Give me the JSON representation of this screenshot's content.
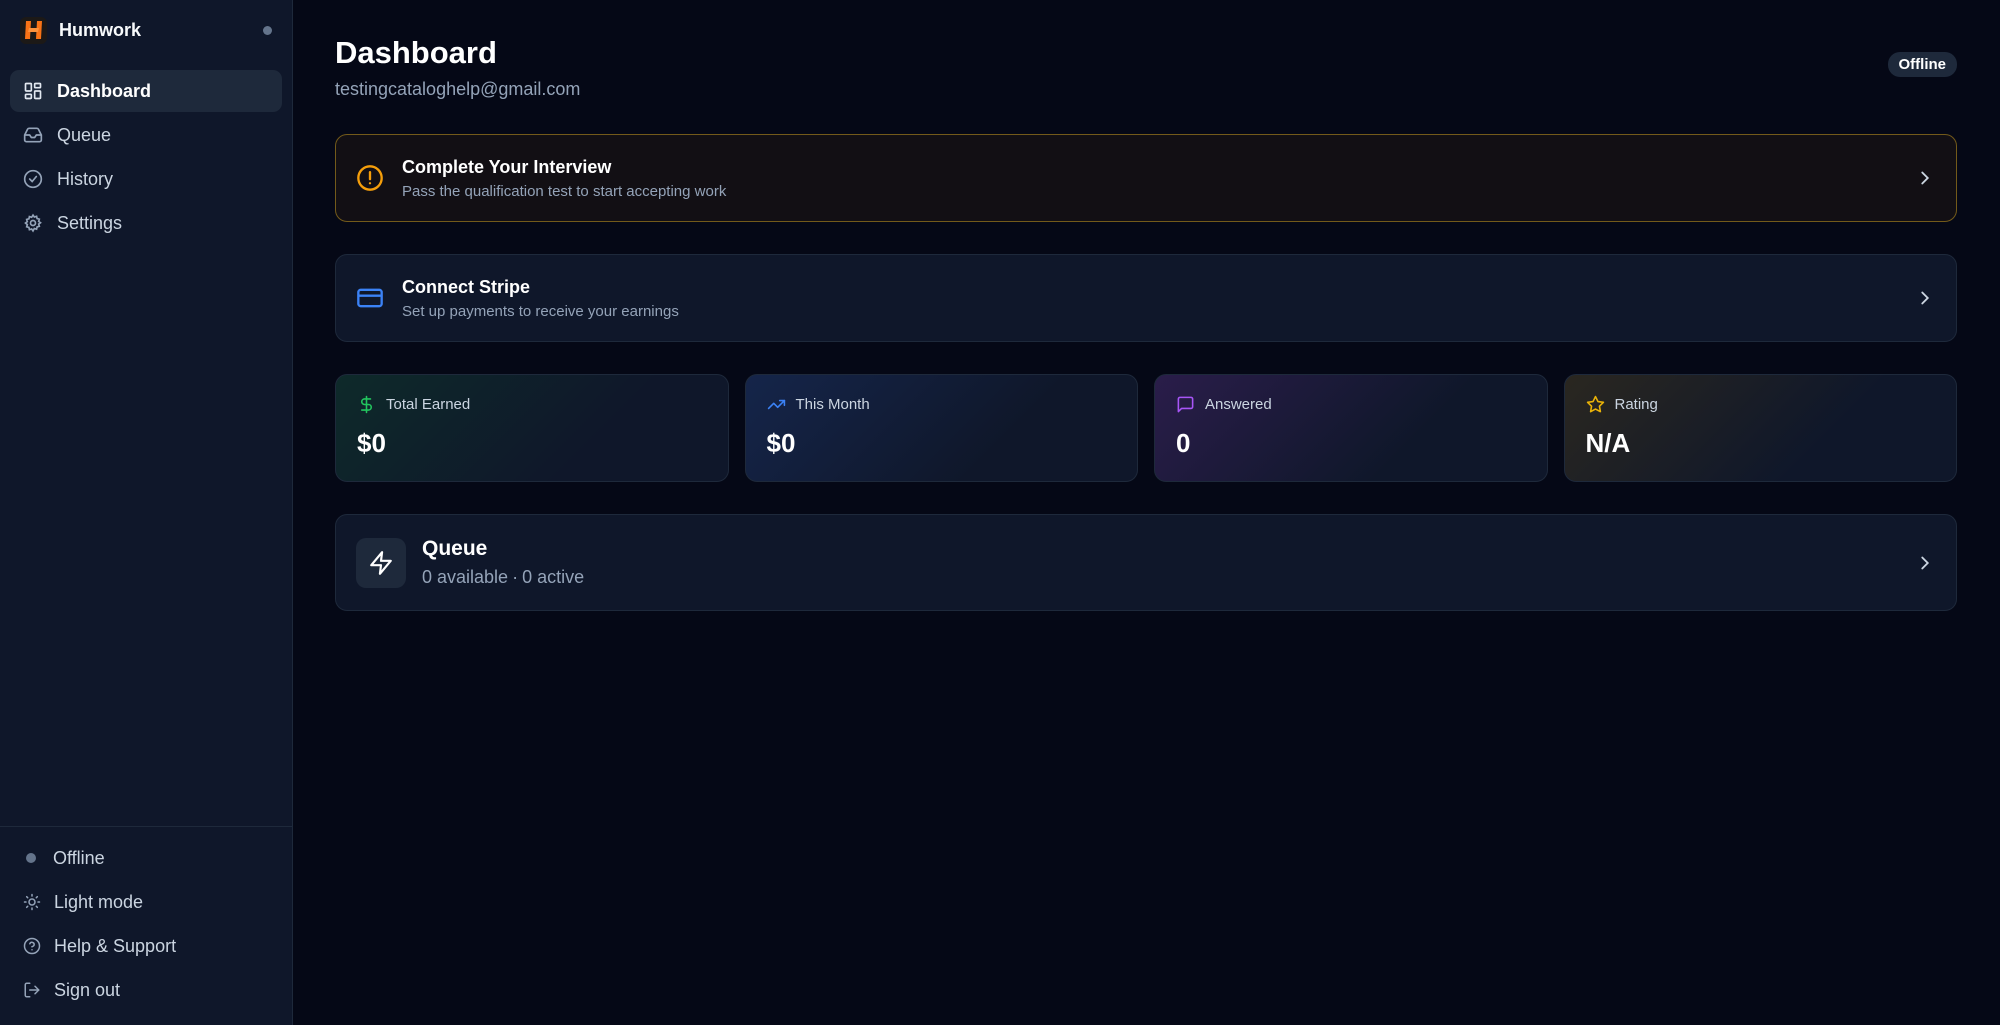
{
  "brand": {
    "name": "Humwork"
  },
  "sidebar": {
    "items": [
      {
        "label": "Dashboard",
        "icon": "dashboard-icon",
        "active": true
      },
      {
        "label": "Queue",
        "icon": "inbox-icon"
      },
      {
        "label": "History",
        "icon": "check-circle-icon"
      },
      {
        "label": "Settings",
        "icon": "gear-icon"
      }
    ],
    "footer": {
      "status_label": "Offline",
      "theme_label": "Light mode",
      "help_label": "Help & Support",
      "signout_label": "Sign out"
    }
  },
  "header": {
    "title": "Dashboard",
    "email": "testingcataloghelp@gmail.com",
    "status_badge": "Offline"
  },
  "banners": {
    "interview": {
      "title": "Complete Your Interview",
      "subtitle": "Pass the qualification test to start accepting work",
      "icon": "alert-circle-icon"
    },
    "stripe": {
      "title": "Connect Stripe",
      "subtitle": "Set up payments to receive your earnings",
      "icon": "credit-card-icon"
    }
  },
  "stats": [
    {
      "label": "Total Earned",
      "value": "$0",
      "icon": "dollar-icon",
      "color": "#22c55e"
    },
    {
      "label": "This Month",
      "value": "$0",
      "icon": "trending-up-icon",
      "color": "#3b82f6"
    },
    {
      "label": "Answered",
      "value": "0",
      "icon": "message-square-icon",
      "color": "#a855f7"
    },
    {
      "label": "Rating",
      "value": "N/A",
      "icon": "star-icon",
      "color": "#eab308"
    }
  ],
  "queue": {
    "title": "Queue",
    "available": "0 available",
    "separator": "·",
    "active": "0 active",
    "icon": "lightning-icon"
  },
  "colors": {
    "background": "#050816",
    "sidebar": "#0f172a",
    "warning": "#f59e0b",
    "accent_blue": "#3b82f6",
    "logo": "#f97316"
  }
}
